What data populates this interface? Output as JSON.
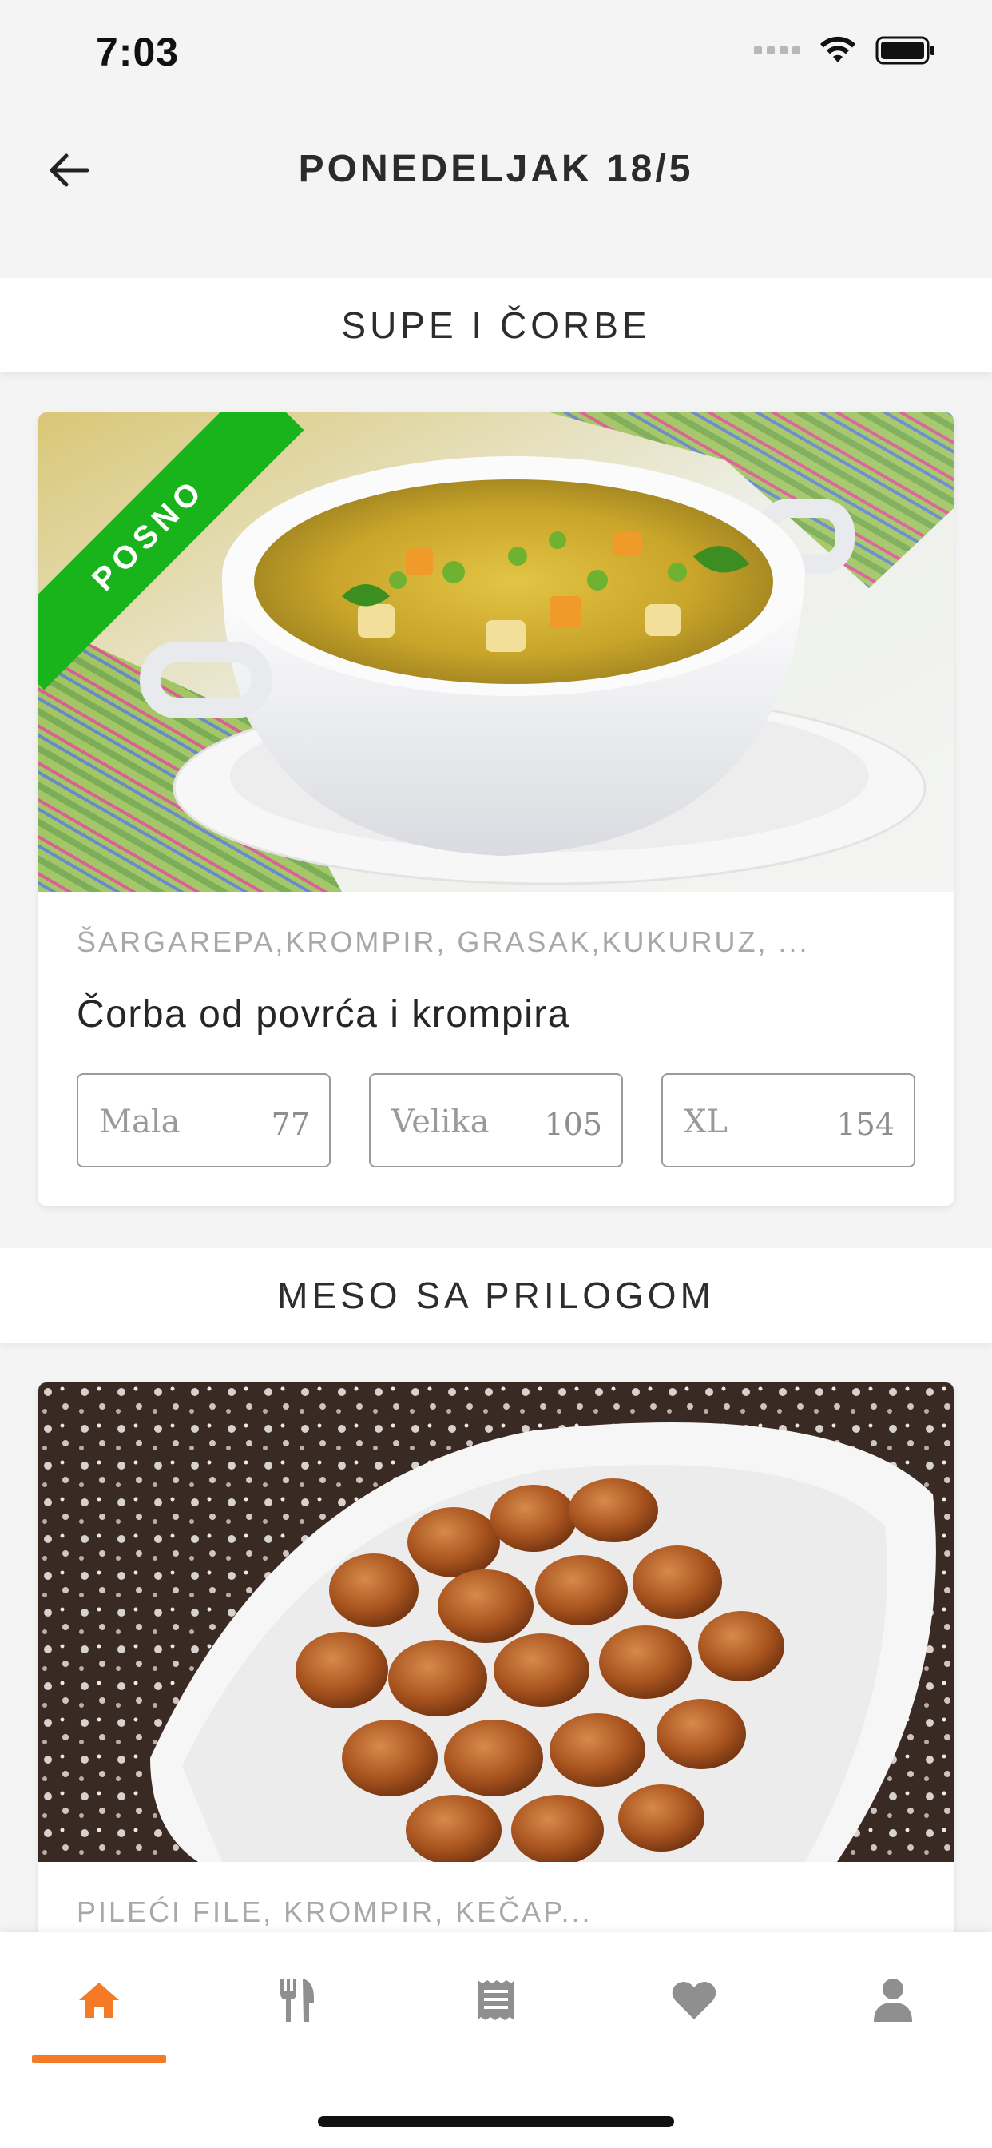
{
  "status_bar": {
    "time": "7:03"
  },
  "header": {
    "title": "PONEDELJAK 18/5"
  },
  "sections": [
    {
      "title": "SUPE I ČORBE",
      "card": {
        "badge": "POSNO",
        "ingredients": "ŠARGAREPA,KROMPIR, GRASAK,KUKURUZ, ...",
        "name": "Čorba od povrća i krompira",
        "sizes": [
          {
            "label": "Mala",
            "price": "77"
          },
          {
            "label": "Velika",
            "price": "105"
          },
          {
            "label": "XL",
            "price": "154"
          }
        ]
      }
    },
    {
      "title": "MESO SA PRILOGOM",
      "card": {
        "ingredients": "PILEĆI FILE, KROMPIR, KEČAP..."
      }
    }
  ],
  "bottom_nav": {
    "items": [
      {
        "icon": "home-icon",
        "active": true
      },
      {
        "icon": "fork-knife-icon",
        "active": false
      },
      {
        "icon": "receipt-icon",
        "active": false
      },
      {
        "icon": "heart-icon",
        "active": false
      },
      {
        "icon": "user-icon",
        "active": false
      }
    ]
  },
  "colors": {
    "accent": "#f47a25",
    "badge": "#19b31b",
    "inactive_icon": "#8f8f8f",
    "background": "#f4f4f4"
  }
}
